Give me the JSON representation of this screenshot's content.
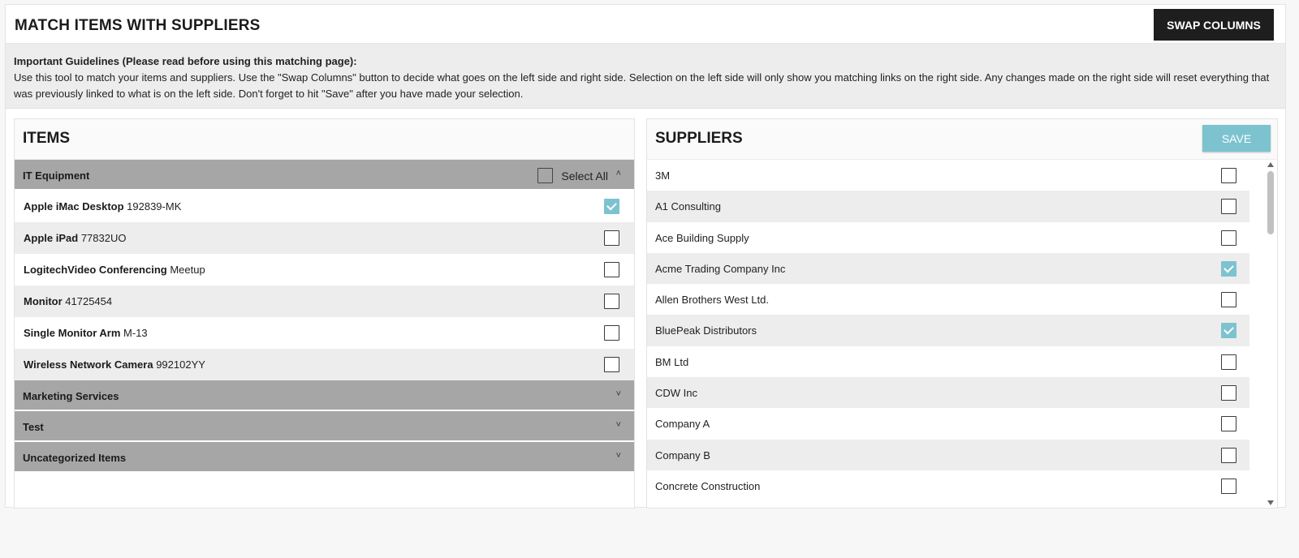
{
  "header": {
    "title": "MATCH ITEMS WITH SUPPLIERS",
    "swap_label": "SWAP COLUMNS"
  },
  "guidelines": {
    "title": "Important Guidelines (Please read before using this matching page):",
    "body": "Use this tool to match your items and suppliers. Use the \"Swap Columns\" button to decide what goes on the left side and right side. Selection on the left side will only show you matching links on the right side. Any changes made on the right side will reset everything that was previously linked to what is on the left side. Don't forget to hit \"Save\" after you have made your selection."
  },
  "items": {
    "title": "ITEMS",
    "select_all_label": "Select All",
    "groups": [
      {
        "name": "IT Equipment",
        "expanded": true,
        "rows": [
          {
            "name": "Apple iMac Desktop",
            "code": "192839-MK",
            "checked": true
          },
          {
            "name": "Apple iPad",
            "code": "77832UO",
            "checked": false
          },
          {
            "name": "LogitechVideo Conferencing",
            "code": "Meetup",
            "checked": false
          },
          {
            "name": "Monitor",
            "code": "41725454",
            "checked": false
          },
          {
            "name": "Single Monitor Arm",
            "code": "M-13",
            "checked": false
          },
          {
            "name": "Wireless Network Camera",
            "code": "992102YY",
            "checked": false
          }
        ]
      },
      {
        "name": "Marketing Services",
        "expanded": false
      },
      {
        "name": "Test",
        "expanded": false
      },
      {
        "name": "Uncategorized Items",
        "expanded": false
      }
    ]
  },
  "suppliers": {
    "title": "SUPPLIERS",
    "save_label": "SAVE",
    "rows": [
      {
        "name": "3M",
        "checked": false
      },
      {
        "name": "A1 Consulting",
        "checked": false
      },
      {
        "name": "Ace Building Supply",
        "checked": false
      },
      {
        "name": "Acme Trading Company Inc",
        "checked": true
      },
      {
        "name": "Allen Brothers West Ltd.",
        "checked": false
      },
      {
        "name": "BluePeak Distributors",
        "checked": true
      },
      {
        "name": "BM Ltd",
        "checked": false
      },
      {
        "name": "CDW Inc",
        "checked": false
      },
      {
        "name": "Company A",
        "checked": false
      },
      {
        "name": "Company B",
        "checked": false
      },
      {
        "name": "Concrete Construction",
        "checked": false
      }
    ]
  },
  "colors": {
    "accent": "#7cc3cf",
    "group_header": "#a6a6a6",
    "dark_button": "#1e1e1e"
  }
}
